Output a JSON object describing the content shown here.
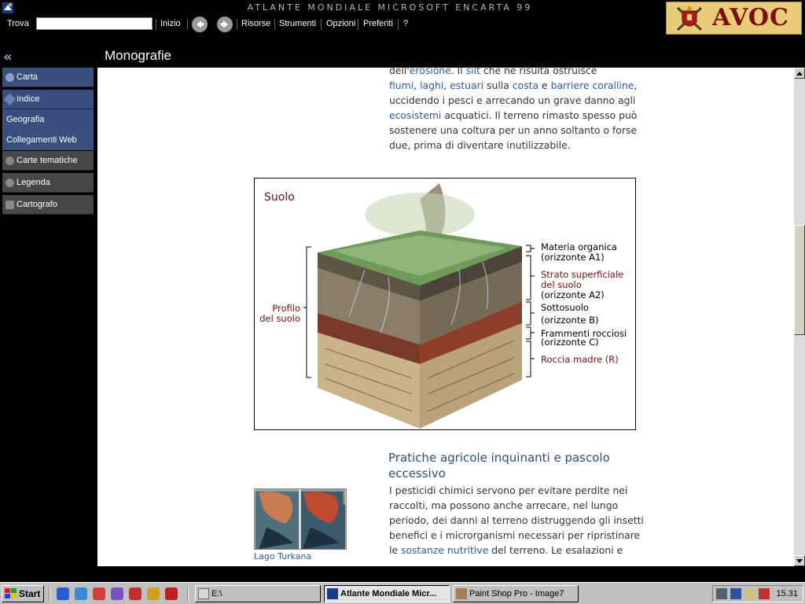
{
  "window": {
    "title": "ATLANTE MONDIALE MICROSOFT ENCARTA 99"
  },
  "menu": {
    "find_label": "Trova",
    "search_value": "",
    "home_label": "Inizio",
    "items": [
      "Risorse",
      "Strumenti",
      "Opzioni",
      "Preferiti",
      "?"
    ]
  },
  "logo": {
    "text": "AVOC"
  },
  "sidebar": {
    "carta": "Carta",
    "indice": "Indice",
    "geografia": "Geografia",
    "collegamenti": "Collegamenti Web",
    "carte_tematiche": "Carte tematiche",
    "legenda": "Legenda",
    "cartografo": "Cartografo"
  },
  "page": {
    "title": "Monografie"
  },
  "article": {
    "p1_top": "dell'",
    "p1_erosione": "erosione",
    "p1_mid1": ". Il ",
    "p1_silt": "silt",
    "p1_mid2": " che ne risulta ostruisce",
    "p1_fiumi": "fiumi",
    "p1_c1": ", ",
    "p1_laghi": "laghi",
    "p1_c2": ", ",
    "p1_estuari": "estuari",
    "p1_sulla": " sulla ",
    "p1_costa": "costa",
    "p1_e": " e ",
    "p1_barriere": "barriere coralline",
    "p1_mid3": ", uccidendo i pesci e arrecando un grave danno agli ",
    "p1_ecosistemi": "ecosistemi",
    "p1_end": " acquatici. Il terreno rimasto spesso può sostenere una coltura per un anno soltanto o forse due, prima di diventare inutilizzabile.",
    "figure_title": "Suolo",
    "labels": {
      "materia": "Materia organica",
      "materia_sub": "(orizzonte A1)",
      "strato": "Strato superficiale",
      "strato2": "del suolo",
      "strato_sub": "(orizzonte A2)",
      "sottosuolo": "Sottosuolo",
      "sottosuolo_sub": "(orizzonte B)",
      "frammenti": "Frammenti rocciosi",
      "frammenti_sub": "(orizzonte C)",
      "roccia": "Roccia madre (R)",
      "profilo": "Profilo",
      "profilo2": "del suolo"
    },
    "section_heading": "Pratiche agricole inquinanti e pascolo eccessivo",
    "p2_text": "I pesticidi chimici servono per evitare perdite nei raccolti, ma possono anche arrecare, nel lungo periodo, dei danni al terreno distruggendo gli insetti benefici e i microrganismi necessari per ripristinare le ",
    "p2_link": "sostanze nutritive",
    "p2_end": " del terreno. Le esalazioni e",
    "thumb_caption": "Lago Turkana"
  },
  "taskbar": {
    "start": "Start",
    "tasks": [
      "E:\\",
      "Atlante Mondiale Micr...",
      "Paint Shop Pro - Image7"
    ],
    "clock": "15.31"
  },
  "colors": {
    "link": "#2f5aa8",
    "sidebar_blue": "#3a4f7d",
    "heading": "#2c4f7c",
    "label_red": "#7a1010"
  }
}
